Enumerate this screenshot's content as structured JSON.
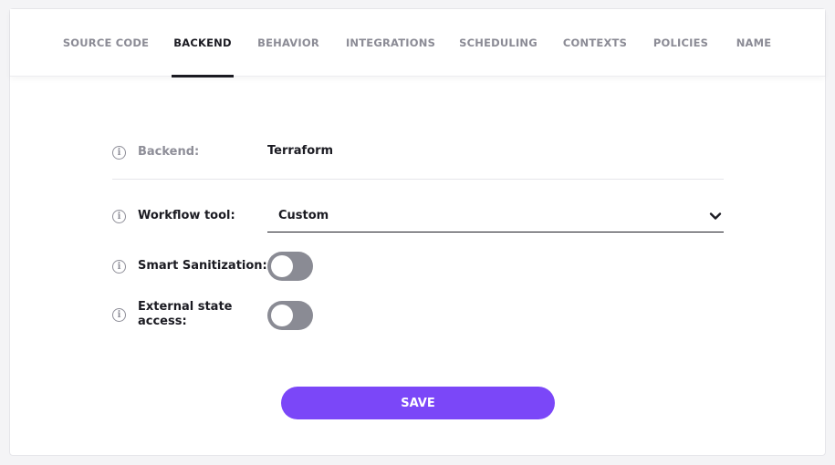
{
  "tabs": [
    {
      "label": "SOURCE CODE",
      "active": false
    },
    {
      "label": "BACKEND",
      "active": true
    },
    {
      "label": "BEHAVIOR",
      "active": false
    },
    {
      "label": "INTEGRATIONS",
      "active": false
    },
    {
      "label": "SCHEDULING",
      "active": false
    },
    {
      "label": "CONTEXTS",
      "active": false
    },
    {
      "label": "POLICIES",
      "active": false
    },
    {
      "label": "NAME",
      "active": false
    }
  ],
  "form": {
    "backend": {
      "label": "Backend:",
      "value": "Terraform",
      "info_icon": "info-icon"
    },
    "workflow_tool": {
      "label": "Workflow tool:",
      "selected": "Custom",
      "info_icon": "info-icon",
      "dropdown_icon": "chevron-down-icon"
    },
    "smart_sanitization": {
      "label": "Smart Sanitization:",
      "enabled": false,
      "info_icon": "info-icon"
    },
    "external_state_access": {
      "label_line1": "External state",
      "label_line2": "access:",
      "enabled": false,
      "info_icon": "info-icon"
    }
  },
  "save_label": "SAVE",
  "colors": {
    "accent": "#7b47f8",
    "toggle_off": "#8a8b94",
    "text_dark": "#1b1b22",
    "text_muted": "#8e8e98"
  }
}
